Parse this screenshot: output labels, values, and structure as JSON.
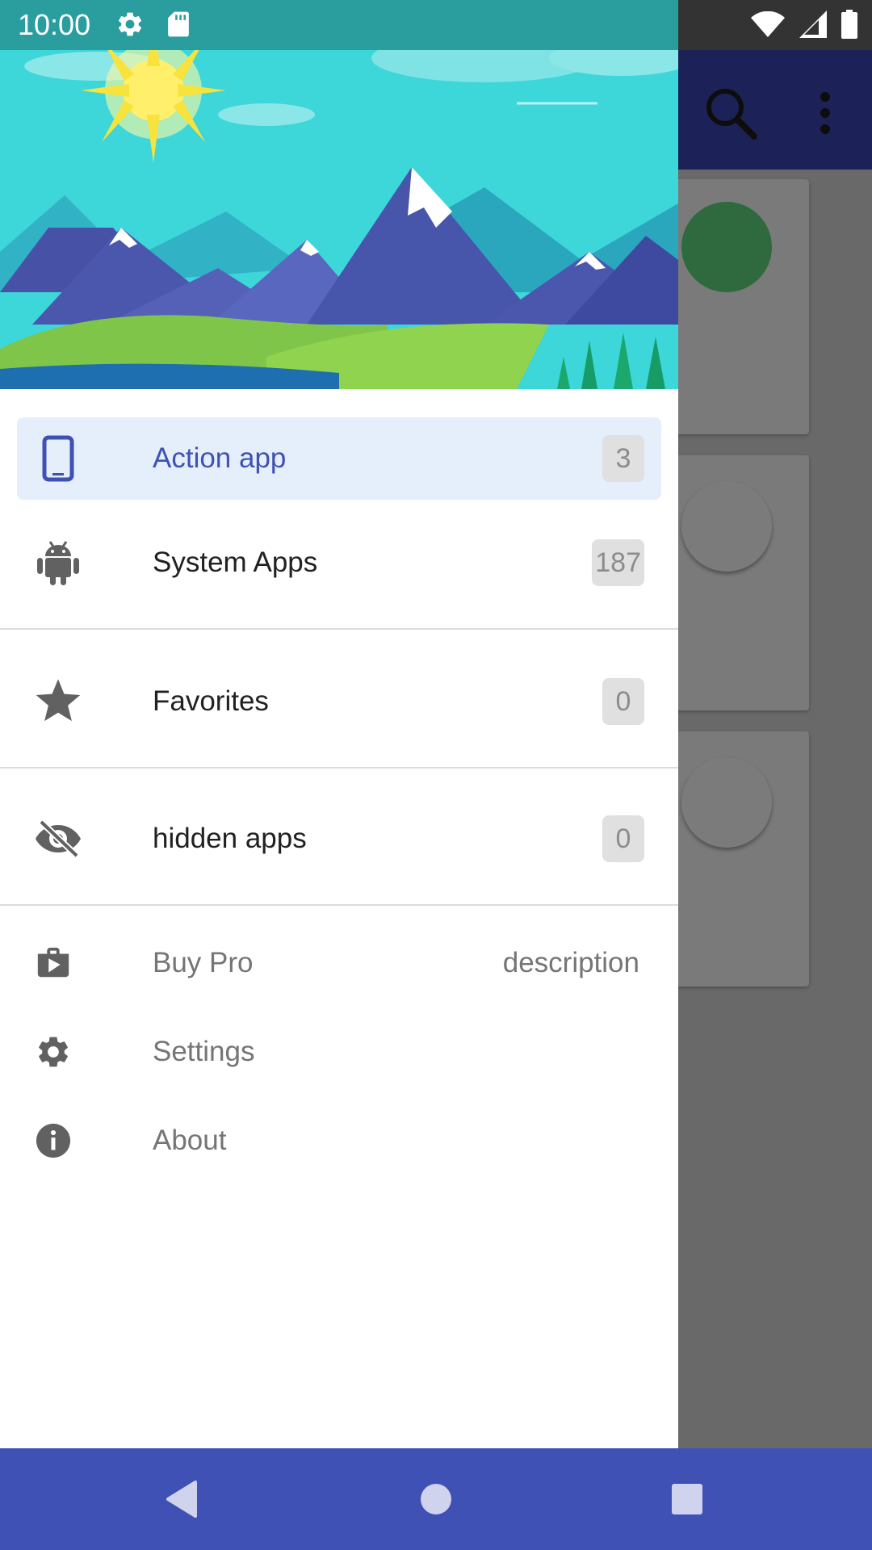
{
  "status_bar": {
    "time": "10:00",
    "icons_left": [
      "gear-icon",
      "sd-card-icon"
    ],
    "icons_right": [
      "wifi-icon",
      "signal-icon",
      "battery-icon"
    ]
  },
  "drawer": {
    "header_image": "mountain-landscape",
    "primary_items": [
      {
        "label": "Action app",
        "count": "3",
        "icon": "phone-icon",
        "active": true
      },
      {
        "label": "System Apps",
        "count": "187",
        "icon": "android-icon",
        "active": false
      }
    ],
    "favorites": {
      "label": "Favorites",
      "count": "0",
      "icon": "star-icon"
    },
    "hidden": {
      "label": "hidden apps",
      "count": "0",
      "icon": "eye-off-icon"
    },
    "secondary_items": [
      {
        "label": "Buy Pro",
        "description": "description",
        "icon": "shop-bag-icon"
      },
      {
        "label": "Settings",
        "icon": "gear-icon"
      },
      {
        "label": "About",
        "icon": "info-icon"
      }
    ]
  },
  "colors": {
    "accent": "#3f51b5",
    "active_bg": "#e4effb",
    "status_bar": "#2a9d9e",
    "nav_bar": "#3f51b5"
  },
  "nav_bar": {
    "buttons": [
      "back-icon",
      "home-icon",
      "recents-icon"
    ]
  }
}
